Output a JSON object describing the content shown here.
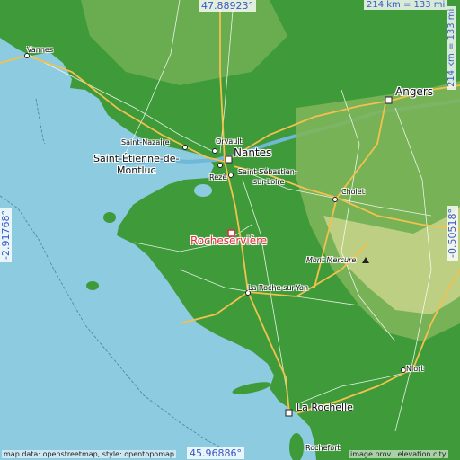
{
  "map": {
    "place_name": "Rocheservière",
    "lat_top": "47.88923°",
    "lat_bottom": "45.96886°",
    "lon_left": "-2.91768°",
    "lon_right": "-0.50518°",
    "scale_top": "214 km = 133 mi",
    "scale_right": "214 km = 133 mi",
    "credit_left": "map data: openstreetmap, style: opentopomap",
    "credit_right": "image prov.: elevation.city",
    "labels": {
      "vannes": "Vannes",
      "angers": "Angers",
      "saint_nazaire": "Saint-Nazaire",
      "orvault": "Orvault",
      "nantes": "Nantes",
      "saint_etienne_1": "Saint-Étienne-de-",
      "saint_etienne_2": "Montluc",
      "reze": "Rezé",
      "saint_sebastien_1": "Saint-Sébastien-",
      "saint_sebastien_2": "sur-Loire",
      "cholet": "Cholet",
      "mont_mercure": "Mont Mercure",
      "la_roche_sur_yon": "La Roche-sur-Yon",
      "niort": "Niort",
      "la_rochelle": "La Rochelle",
      "rochefort_partial": "Rochefort"
    },
    "colors": {
      "sea": "#8ccbe0",
      "lowland": "#3f9a3a",
      "midland": "#7db55a",
      "upland": "#c8d48a",
      "road_major": "#f2c14e",
      "road_minor": "#ffffff",
      "highlight": "#e0303a",
      "coord_text": "#3a57c8"
    }
  }
}
